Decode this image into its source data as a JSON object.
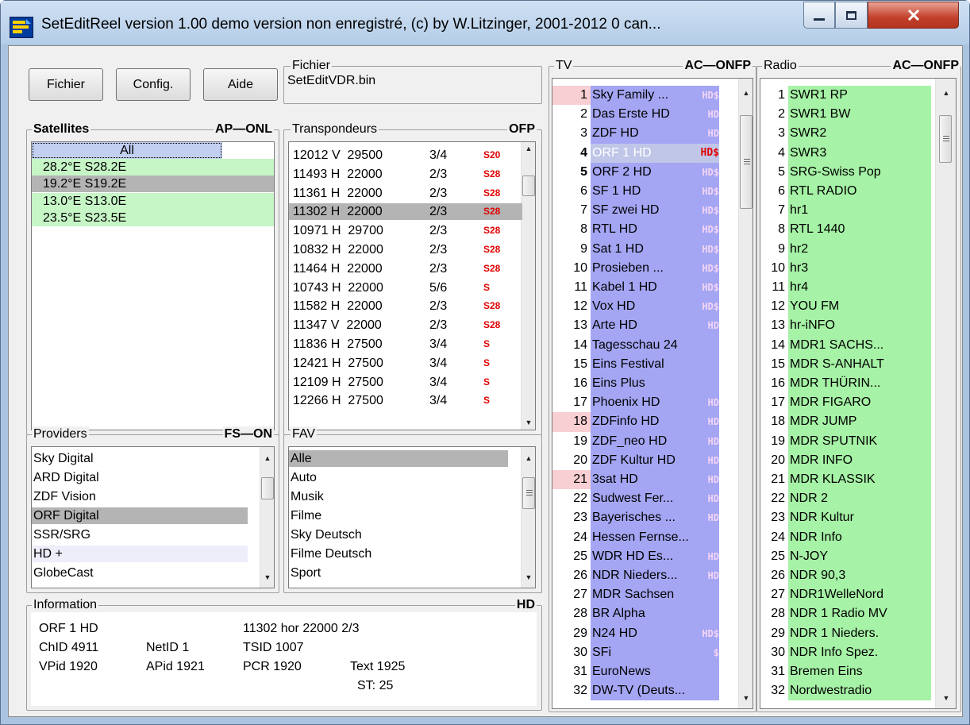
{
  "window": {
    "title": "SetEditReel version  1.00  demo version non enregistré, (c) by W.Litzinger, 2001-2012 0  can...",
    "controls": [
      "minimize-icon",
      "maximize-icon",
      "close-icon"
    ]
  },
  "toolbar": {
    "file_label": "Fichier",
    "config_label": "Config.",
    "help_label": "Aide"
  },
  "file": {
    "group_label": "Fichier",
    "value": "SetEditVDR.bin"
  },
  "satellites": {
    "group_label": "Satellites",
    "flags": "AP—ONL",
    "items": [
      {
        "label": "All",
        "state": "focused"
      },
      {
        "label": "28.2°E  S28.2E",
        "state": "green"
      },
      {
        "label": "19.2°E  S19.2E",
        "state": "selected"
      },
      {
        "label": "13.0°E  S13.0E",
        "state": "green"
      },
      {
        "label": "23.5°E  S23.5E",
        "state": "green"
      }
    ]
  },
  "transponders": {
    "group_label": "Transpondeurs",
    "flags": "OFP",
    "items": [
      {
        "freq": "12012 V  29500",
        "fec": "3/4",
        "tag": "S20",
        "selected": false
      },
      {
        "freq": "11493 H  22000",
        "fec": "2/3",
        "tag": "S28",
        "selected": false
      },
      {
        "freq": "11361 H  22000",
        "fec": "2/3",
        "tag": "S28",
        "selected": false
      },
      {
        "freq": "11302 H  22000",
        "fec": "2/3",
        "tag": "S28",
        "selected": true
      },
      {
        "freq": "10971 H  29700",
        "fec": "2/3",
        "tag": "S28",
        "selected": false
      },
      {
        "freq": "10832 H  22000",
        "fec": "2/3",
        "tag": "S28",
        "selected": false
      },
      {
        "freq": "11464 H  22000",
        "fec": "2/3",
        "tag": "S28",
        "selected": false
      },
      {
        "freq": "10743 H  22000",
        "fec": "5/6",
        "tag": "S",
        "selected": false
      },
      {
        "freq": "11582 H  22000",
        "fec": "2/3",
        "tag": "S28",
        "selected": false
      },
      {
        "freq": "11347 V  22000",
        "fec": "2/3",
        "tag": "S28",
        "selected": false
      },
      {
        "freq": "11836 H  27500",
        "fec": "3/4",
        "tag": "S",
        "selected": false
      },
      {
        "freq": "12421 H  27500",
        "fec": "3/4",
        "tag": "S",
        "selected": false
      },
      {
        "freq": "12109 H  27500",
        "fec": "3/4",
        "tag": "S",
        "selected": false
      },
      {
        "freq": "12266 H  27500",
        "fec": "3/4",
        "tag": "S",
        "selected": false
      }
    ]
  },
  "providers": {
    "group_label": "Providers",
    "flags": "FS—ON",
    "items": [
      "Sky Digital",
      "ARD Digital",
      "ZDF Vision",
      "ORF Digital",
      "SSR/SRG",
      "HD +",
      "GlobeCast"
    ],
    "selected_index": 3,
    "hover_index": 5
  },
  "fav": {
    "group_label": "FAV",
    "items": [
      "Alle",
      "Auto",
      "Musik",
      "Filme",
      "Sky Deutsch",
      "Filme Deutsch",
      "Sport"
    ],
    "selected_index": 0
  },
  "information": {
    "group_label": "Information",
    "flag": "HD",
    "channel": "ORF 1 HD",
    "tp": "11302   hor  22000   2/3",
    "chid": "ChID 4911",
    "netid": "NetID 1",
    "tsid": "TSID 1007",
    "vpid": "VPid 1920",
    "apid": "APid 1921",
    "pcr": "PCR 1920",
    "text": "Text 1925",
    "st": "ST: 25"
  },
  "tv": {
    "group_label": "TV",
    "flags": "AC—ONFP",
    "items": [
      {
        "num": "1",
        "name": "Sky Family ...",
        "flag": "HD$",
        "pink": true
      },
      {
        "num": "2",
        "name": "Das Erste HD",
        "flag": "HD"
      },
      {
        "num": "3",
        "name": "ZDF HD",
        "flag": "HD"
      },
      {
        "num": "4",
        "name": "ORF 1 HD",
        "flag": "HD$",
        "bold": true,
        "current": true
      },
      {
        "num": "5",
        "name": "ORF 2 HD",
        "flag": "HD$",
        "bold": true
      },
      {
        "num": "6",
        "name": "SF 1 HD",
        "flag": "HD$"
      },
      {
        "num": "7",
        "name": "SF zwei HD",
        "flag": "HD$"
      },
      {
        "num": "8",
        "name": "RTL HD",
        "flag": "HD$"
      },
      {
        "num": "9",
        "name": "Sat 1 HD",
        "flag": "HD$"
      },
      {
        "num": "10",
        "name": "Prosieben ...",
        "flag": "HD$"
      },
      {
        "num": "11",
        "name": "Kabel 1 HD",
        "flag": "HD$"
      },
      {
        "num": "12",
        "name": "Vox HD",
        "flag": "HD$"
      },
      {
        "num": "13",
        "name": "Arte HD",
        "flag": "HD"
      },
      {
        "num": "14",
        "name": "Tagesschau 24",
        "flag": ""
      },
      {
        "num": "15",
        "name": "Eins Festival",
        "flag": ""
      },
      {
        "num": "16",
        "name": "Eins Plus",
        "flag": ""
      },
      {
        "num": "17",
        "name": "Phoenix HD",
        "flag": "HD"
      },
      {
        "num": "18",
        "name": "ZDFinfo HD",
        "flag": "HD",
        "pink": true
      },
      {
        "num": "19",
        "name": "ZDF_neo HD",
        "flag": "HD"
      },
      {
        "num": "20",
        "name": "ZDF Kultur HD",
        "flag": "HD"
      },
      {
        "num": "21",
        "name": "3sat HD",
        "flag": "HD",
        "pink": true
      },
      {
        "num": "22",
        "name": "Sudwest Fer...",
        "flag": "HD"
      },
      {
        "num": "23",
        "name": "Bayerisches ...",
        "flag": "HD"
      },
      {
        "num": "24",
        "name": "Hessen Fernse...",
        "flag": ""
      },
      {
        "num": "25",
        "name": "WDR HD Es...",
        "flag": "HD"
      },
      {
        "num": "26",
        "name": "NDR Nieders...",
        "flag": "HD"
      },
      {
        "num": "27",
        "name": "MDR Sachsen",
        "flag": ""
      },
      {
        "num": "28",
        "name": "BR Alpha",
        "flag": ""
      },
      {
        "num": "29",
        "name": "N24 HD",
        "flag": "HD$"
      },
      {
        "num": "30",
        "name": "SFi",
        "flag": "$"
      },
      {
        "num": "31",
        "name": "EuroNews",
        "flag": ""
      },
      {
        "num": "32",
        "name": "DW-TV (Deuts...",
        "flag": ""
      }
    ]
  },
  "radio": {
    "group_label": "Radio",
    "flags": "AC—ONFP",
    "items": [
      {
        "num": "1",
        "name": "SWR1 RP"
      },
      {
        "num": "2",
        "name": "SWR1 BW"
      },
      {
        "num": "3",
        "name": "SWR2"
      },
      {
        "num": "4",
        "name": "SWR3"
      },
      {
        "num": "5",
        "name": "SRG-Swiss Pop"
      },
      {
        "num": "6",
        "name": "RTL RADIO"
      },
      {
        "num": "7",
        "name": "hr1"
      },
      {
        "num": "8",
        "name": "RTL 1440"
      },
      {
        "num": "9",
        "name": "hr2"
      },
      {
        "num": "10",
        "name": "hr3"
      },
      {
        "num": "11",
        "name": "hr4"
      },
      {
        "num": "12",
        "name": "YOU FM"
      },
      {
        "num": "13",
        "name": "hr-iNFO"
      },
      {
        "num": "14",
        "name": "MDR1 SACHS..."
      },
      {
        "num": "15",
        "name": "MDR S-ANHALT"
      },
      {
        "num": "16",
        "name": "MDR THÜRIN..."
      },
      {
        "num": "17",
        "name": "MDR FIGARO"
      },
      {
        "num": "18",
        "name": "MDR JUMP"
      },
      {
        "num": "19",
        "name": "MDR SPUTNIK"
      },
      {
        "num": "20",
        "name": "MDR INFO"
      },
      {
        "num": "21",
        "name": "MDR KLASSIK"
      },
      {
        "num": "22",
        "name": "NDR 2"
      },
      {
        "num": "23",
        "name": "NDR Kultur"
      },
      {
        "num": "24",
        "name": "NDR Info"
      },
      {
        "num": "25",
        "name": "N-JOY"
      },
      {
        "num": "26",
        "name": "NDR 90,3"
      },
      {
        "num": "27",
        "name": "NDR1WelleNord"
      },
      {
        "num": "28",
        "name": "NDR 1 Radio MV"
      },
      {
        "num": "29",
        "name": "NDR 1 Nieders."
      },
      {
        "num": "30",
        "name": "NDR Info Spez."
      },
      {
        "num": "31",
        "name": "Bremen Eins"
      },
      {
        "num": "32",
        "name": "Nordwestradio"
      }
    ]
  },
  "colors": {
    "tv_bg": "#a4a6f4",
    "radio_bg": "#a6f2a6",
    "pink": "#f8cfd3",
    "selected": "#b4b4b4",
    "tag_red": "#e00000"
  }
}
